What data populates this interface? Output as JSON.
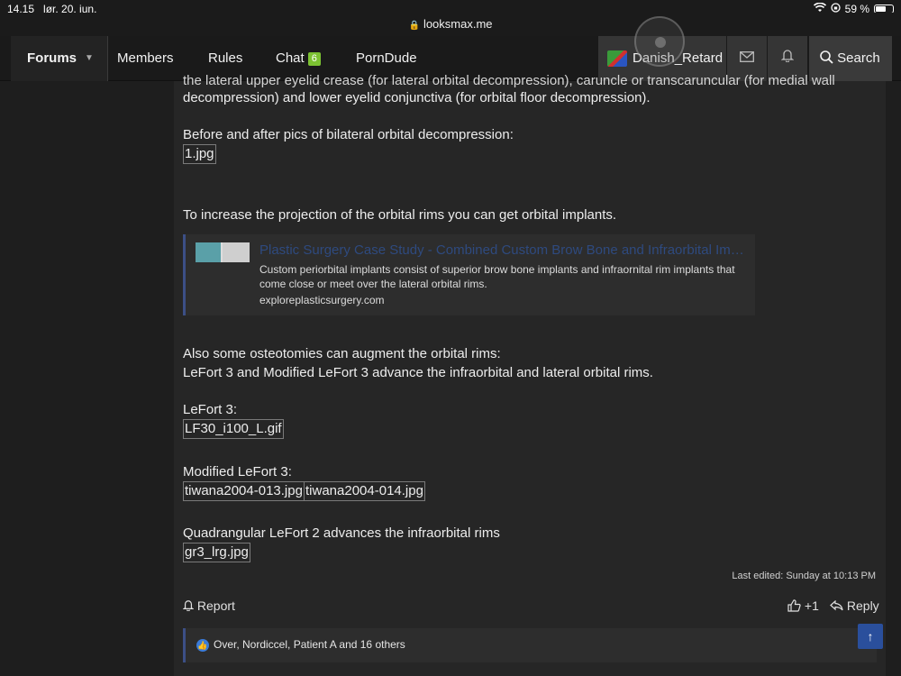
{
  "status_bar": {
    "time": "14.15",
    "date": "lør. 20. jun.",
    "battery_pct": "59 %",
    "battery_level": 0.59
  },
  "browser": {
    "url": "looksmax.me"
  },
  "nav": {
    "forums": "Forums",
    "members": "Members",
    "rules": "Rules",
    "chat": "Chat",
    "chat_badge": "6",
    "porndude": "PornDude",
    "username": "Danish_Retard",
    "search": "Search"
  },
  "post": {
    "line_cut": "the lateral upper eyelid crease (for lateral orbital decompression), caruncle or transcaruncular (for medial wall",
    "line_2": "decompression) and lower eyelid conjunctiva (for orbital floor decompression).",
    "before_after": "Before and after pics of bilateral orbital decompression:",
    "attach_1": "1.jpg",
    "implants_text": "To increase the projection of the orbital rims you can get orbital implants.",
    "unfurl": {
      "title": "Plastic Surgery Case Study - Combined Custom Brow Bone and Infraorbital Implants",
      "description": "Custom periorbital implants consist of superior brow bone implants and infraornital rim implants that come close or meet over the lateral orbital rims.",
      "domain": "exploreplasticsurgery.com"
    },
    "osteotomies": "Also some osteotomies can augment the orbital rims:",
    "lefort_adv": "LeFort 3 and Modified LeFort 3 advance the infraorbital and lateral orbital rims.",
    "lefort3_label": "LeFort 3:",
    "attach_lf30": "LF30_i100_L.gif",
    "modified_label": "Modified LeFort 3:",
    "attach_tiwana13": "tiwana2004-013.jpg",
    "attach_tiwana14": "tiwana2004-014.jpg",
    "quad_text": "Quadrangular LeFort 2 advances the infraorbital rims",
    "attach_gr3": "gr3_lrg.jpg",
    "last_edited": "Last edited: Sunday at 10:13 PM",
    "report": "Report",
    "like_count": "+1",
    "reply": "Reply",
    "reactions": "Over, Nordiccel, Patient A and 16 others"
  }
}
